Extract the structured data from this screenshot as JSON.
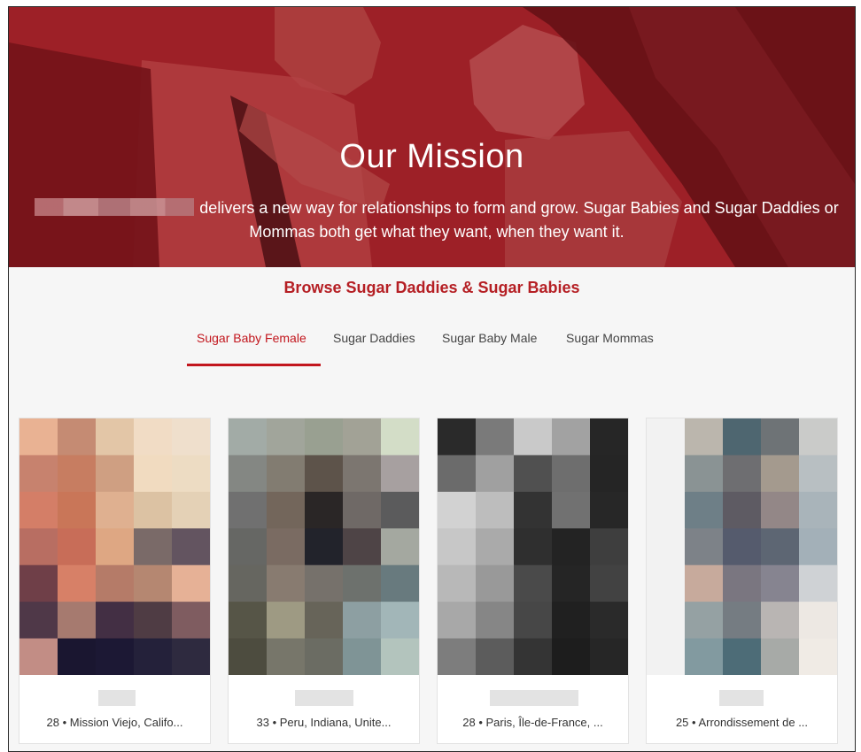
{
  "hero": {
    "title": "Our Mission",
    "description": "delivers a new way for relationships to form and grow. Sugar Babies and Sugar Daddies or Mommas both get what they want, when they want it."
  },
  "browse": {
    "title": "Browse Sugar Daddies & Sugar Babies",
    "tabs": [
      {
        "label": "Sugar Baby Female",
        "active": true
      },
      {
        "label": "Sugar Daddies",
        "active": false
      },
      {
        "label": "Sugar Baby Male",
        "active": false
      },
      {
        "label": "Sugar Mommas",
        "active": false
      }
    ]
  },
  "profiles": [
    {
      "age": "28",
      "location": "Mission Viejo, Califo...",
      "meta": "28 • Mission Viejo, Califo...",
      "palette": [
        [
          "#e9b293",
          "#c58b73",
          "#e3c6a7",
          "#f1dcc5",
          "#efdfcc"
        ],
        [
          "#c7826e",
          "#c77d61",
          "#cf9f82",
          "#f1dbc0",
          "#eddcc3"
        ],
        [
          "#d47e67",
          "#c97658",
          "#dfb090",
          "#dcc2a3",
          "#e4d1b6"
        ],
        [
          "#b86e62",
          "#c86d58",
          "#dea783",
          "#7a6a68",
          "#635460"
        ],
        [
          "#6f3f48",
          "#d78067",
          "#b57b68",
          "#b58771",
          "#e6b196"
        ],
        [
          "#4f3848",
          "#a67a6f",
          "#432f44",
          "#4f3c44",
          "#7f5c60"
        ],
        [
          "#c28d85",
          "#1a1630",
          "#1c1834",
          "#24213a",
          "#2e2a3f"
        ]
      ]
    },
    {
      "age": "33",
      "location": "Peru, Indiana, Unite...",
      "meta": "33 • Peru, Indiana, Unite...",
      "palette": [
        [
          "#a2aba6",
          "#a1a59b",
          "#99a091",
          "#a2a296",
          "#d3ddc7"
        ],
        [
          "#848783",
          "#827c71",
          "#5d534a",
          "#7c7670",
          "#a7a0a0"
        ],
        [
          "#707070",
          "#73665b",
          "#2a2626",
          "#6f6966",
          "#5b5b5c"
        ],
        [
          "#666764",
          "#7a6b62",
          "#22232b",
          "#4e4446",
          "#a4a8a0"
        ],
        [
          "#666660",
          "#887b70",
          "#76716b",
          "#6d716d",
          "#687a7e"
        ],
        [
          "#565547",
          "#9e9a83",
          "#676459",
          "#8d9fa2",
          "#a2b6b8"
        ],
        [
          "#4d4c3f",
          "#77766a",
          "#6b6c63",
          "#7f9496",
          "#b3c4bd"
        ]
      ]
    },
    {
      "age": "28",
      "location": "Paris, Île-de-France, ...",
      "meta": "28 • Paris, Île-de-France, ...",
      "palette": [
        [
          "#2a2a2a",
          "#7a7a7a",
          "#c9c9c9",
          "#a2a2a2",
          "#262626"
        ],
        [
          "#6b6b6b",
          "#a0a0a0",
          "#505050",
          "#6e6e6e",
          "#252525"
        ],
        [
          "#d2d2d2",
          "#bdbdbd",
          "#333333",
          "#717171",
          "#272727"
        ],
        [
          "#c7c7c7",
          "#aaaaaa",
          "#2f2f2f",
          "#232323",
          "#3e3e3e"
        ],
        [
          "#b8b8b8",
          "#999999",
          "#4a4a4a",
          "#252525",
          "#424242"
        ],
        [
          "#a8a8a8",
          "#868686",
          "#474747",
          "#202020",
          "#2a2a2a"
        ],
        [
          "#7d7d7d",
          "#5c5c5c",
          "#343434",
          "#1d1d1d",
          "#262626"
        ]
      ]
    },
    {
      "age": "25",
      "location": "Arrondissement de ...",
      "meta": "25 • Arrondissement de ...",
      "palette": [
        [
          "#f2f2f2",
          "#bbb6ad",
          "#4e6670",
          "#6e7376",
          "#cacbc9"
        ],
        [
          "#f2f2f2",
          "#8a9394",
          "#6e6e71",
          "#a49a8e",
          "#b8bfc2"
        ],
        [
          "#f2f2f2",
          "#6e7f87",
          "#5e5b63",
          "#938787",
          "#a9b4ba"
        ],
        [
          "#f2f2f2",
          "#7d8288",
          "#555b6d",
          "#5d6673",
          "#a3b0b8"
        ],
        [
          "#f2f2f2",
          "#c7aa9c",
          "#7a7680",
          "#868490",
          "#cfd2d5"
        ],
        [
          "#f2f2f2",
          "#95a1a3",
          "#757c82",
          "#b9b5b3",
          "#ede8e3"
        ],
        [
          "#f2f2f2",
          "#829aa0",
          "#4d6c77",
          "#a7aaa7",
          "#f0ebe5"
        ]
      ]
    }
  ]
}
